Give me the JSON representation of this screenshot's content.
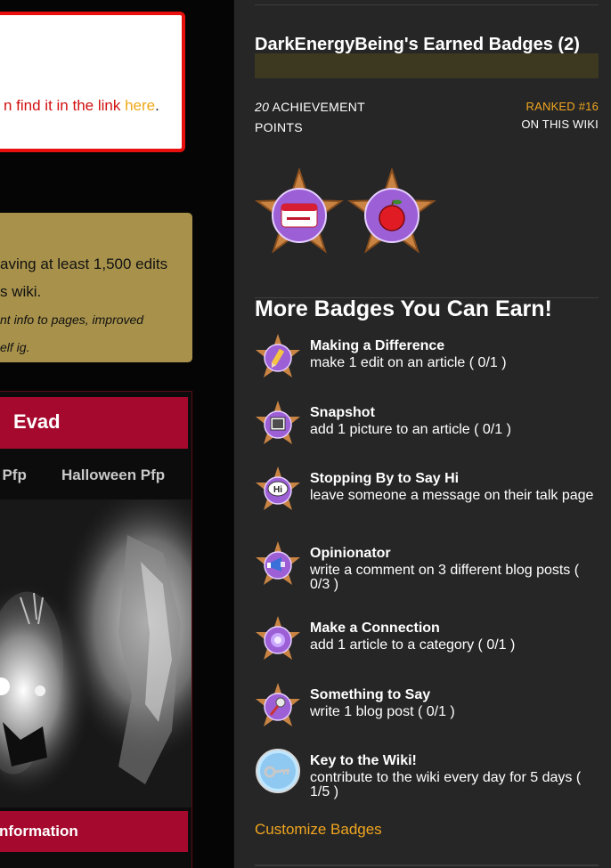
{
  "left": {
    "notice_text": "n find it in the link ",
    "notice_link": "here",
    "notice_period": ".",
    "gold_line1": "aving at least 1,500 edits",
    "gold_line2": "s wiki.",
    "gold_line3": "nt info to pages, improved",
    "gold_line4": "elf ig.",
    "infobox_title": "Evad",
    "tabs": [
      "l Pfp",
      "Halloween Pfp"
    ],
    "information_header": "nformation"
  },
  "panel": {
    "earned_title": "DarkEnergyBeing's Earned Badges (2)",
    "points_value": "20",
    "points_label_1": " ACHIEVEMENT",
    "points_label_2": "POINTS",
    "rank_line1": "RANKED #16",
    "rank_line2": "ON THIS WIKI",
    "earned_badges": [
      {
        "icon": "name-tag-badge-icon"
      },
      {
        "icon": "apple-badge-icon"
      }
    ],
    "more_title": "More Badges You Can Earn!",
    "badges": [
      {
        "name": "Making a Difference",
        "desc": "make 1 edit on an article ( 0/1 )",
        "icon": "pencil-badge-icon"
      },
      {
        "name": "Snapshot",
        "desc": "add 1 picture to an article ( 0/1 )",
        "icon": "picture-badge-icon"
      },
      {
        "name": "Stopping By to Say Hi",
        "desc": "leave someone a message on their talk page",
        "icon": "hi-bubble-badge-icon"
      },
      {
        "name": "Opinionator",
        "desc": "write a comment on 3 different blog posts ( 0/3 )",
        "icon": "megaphone-badge-icon"
      },
      {
        "name": "Make a Connection",
        "desc": "add 1 article to a category ( 0/1 )",
        "icon": "connection-badge-icon"
      },
      {
        "name": "Something to Say",
        "desc": "write 1 blog post ( 0/1 )",
        "icon": "microphone-badge-icon"
      },
      {
        "name": "Key to the Wiki!",
        "desc": "contribute to the wiki every day for 5 days ( 1/5 )",
        "icon": "key-badge-icon"
      }
    ],
    "customize_label": "Customize Badges"
  },
  "colors": {
    "panel_bg": "#262626",
    "accent_orange": "#f0a51f",
    "infobox_red": "#a50a2e",
    "notice_border": "#e8100e",
    "gold_box": "#a8924b"
  }
}
